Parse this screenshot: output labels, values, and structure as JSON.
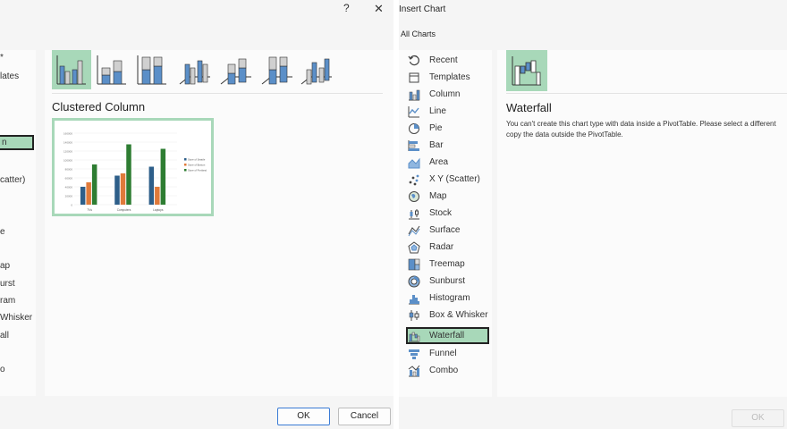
{
  "left_dialog": {
    "help_glyph": "?",
    "close_glyph": "✕",
    "category_fragments": [
      "lates",
      "n",
      "catter)",
      "e",
      "ap",
      "urst",
      "ram",
      "Whisker",
      "all",
      "o"
    ],
    "subtype_title": "Clustered Column",
    "ok_label": "OK",
    "cancel_label": "Cancel",
    "preview": {
      "categories": [
        "TVs",
        "Computers",
        "Laptops"
      ],
      "series": [
        {
          "name": "Store of Seattle",
          "color": "#2e5f8a",
          "values": [
            40000,
            65000,
            85000
          ]
        },
        {
          "name": "Store of Boston",
          "color": "#e07a3a",
          "values": [
            50000,
            70000,
            40000
          ]
        },
        {
          "name": "Store of Portland",
          "color": "#2e7d32",
          "values": [
            90000,
            135000,
            125000
          ]
        }
      ],
      "ticks": [
        "160000",
        "140000",
        "120000",
        "100000",
        "80000",
        "60000",
        "40000",
        "20000",
        "0"
      ]
    }
  },
  "right_dialog": {
    "title": "Insert Chart",
    "tab": "All Charts",
    "categories": [
      "Recent",
      "Templates",
      "Column",
      "Line",
      "Pie",
      "Bar",
      "Area",
      "X Y (Scatter)",
      "Map",
      "Stock",
      "Surface",
      "Radar",
      "Treemap",
      "Sunburst",
      "Histogram",
      "Box & Whisker",
      "Waterfall",
      "Funnel",
      "Combo"
    ],
    "selected_category": "Waterfall",
    "chart_name": "Waterfall",
    "message": "You can't create this chart type with data inside a PivotTable. Please select a different",
    "message_line2": "copy the data outside the PivotTable.",
    "ok_label": "OK"
  },
  "colors": {
    "selection": "#a8d8b9",
    "accent_blue": "#5b8fc8",
    "selected_border": "#222222"
  }
}
